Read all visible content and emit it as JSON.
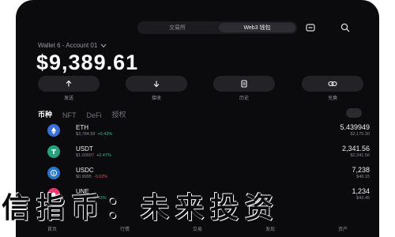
{
  "top_bar": {
    "tabs": [
      {
        "label": "交易所",
        "active": false
      },
      {
        "label": "Web3 钱包",
        "active": true
      }
    ],
    "icons": [
      "scan-icon",
      "search-icon"
    ]
  },
  "wallet": {
    "account_line": "Wallet 6 - Account 01",
    "balance": "$9,389.61"
  },
  "actions": [
    {
      "icon": "arrow-up-icon",
      "label": "发送"
    },
    {
      "icon": "arrow-down-icon",
      "label": "接收"
    },
    {
      "icon": "receipt-icon",
      "label": "历史"
    },
    {
      "icon": "swap-icon",
      "label": "兑换"
    }
  ],
  "asset_tabs": [
    {
      "label": "币种",
      "active": true
    },
    {
      "label": "NFT",
      "active": false
    },
    {
      "label": "DeFi",
      "active": false
    },
    {
      "label": "授权",
      "active": false
    }
  ],
  "assets": [
    {
      "symbol": "ETH",
      "price": "$3,784.59",
      "change": "+0.43%",
      "change_color": "#2ebd85",
      "amount": "5.439949",
      "value": "$2,175.30",
      "coin_color": "#3b6fd8"
    },
    {
      "symbol": "USDT",
      "price": "$1.00007",
      "change": "+0.47%",
      "change_color": "#2ebd85",
      "amount": "2,341.56",
      "value": "$2,341.56",
      "coin_color": "#26a17b"
    },
    {
      "symbol": "USDC",
      "price": "$0.9995",
      "change": "-0.02%",
      "change_color": "#f6465d",
      "amount": "7,238",
      "value": "$48.15",
      "coin_color": "#2775ca"
    },
    {
      "symbol": "UNE",
      "price": "$32.33",
      "change": "+0.43%",
      "change_color": "#2ebd85",
      "amount": "1,234",
      "value": "$43.45",
      "coin_color": "#e5396b"
    }
  ],
  "bottom_nav": [
    "首页",
    "行情",
    "交易",
    "发现",
    "资产"
  ],
  "overlay_text": "信指币：未来投资"
}
